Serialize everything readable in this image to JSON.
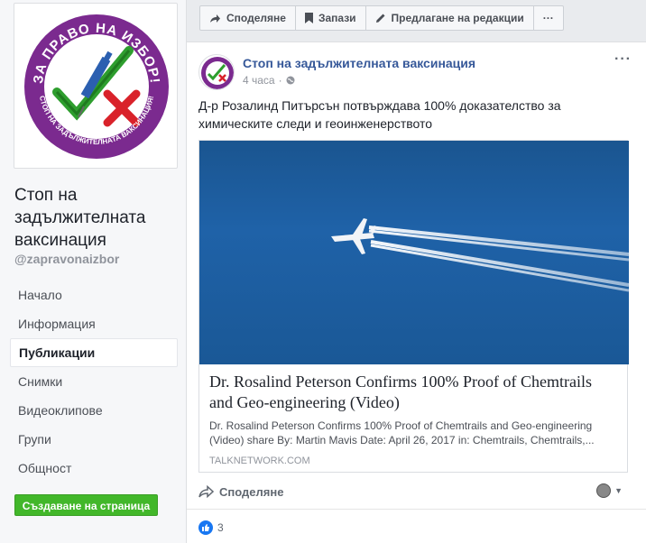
{
  "sidebar": {
    "page_name": "Стоп на задължителната ваксинация",
    "handle": "@zapravonaizbor",
    "logo_text_top": "ЗА ПРАВО НА ИЗБОР!",
    "logo_text_bottom": "СТОП НА ЗАДЪЛЖИТЕЛНАТА ВАКСИНАЦИЯ!",
    "nav_items": [
      {
        "label": "Начало",
        "active": false
      },
      {
        "label": "Информация",
        "active": false
      },
      {
        "label": "Публикации",
        "active": true
      },
      {
        "label": "Снимки",
        "active": false
      },
      {
        "label": "Видеоклипове",
        "active": false
      },
      {
        "label": "Групи",
        "active": false
      },
      {
        "label": "Общност",
        "active": false
      }
    ],
    "create_page_label": "Създаване на страница"
  },
  "action_bar": {
    "share_label": "Споделяне",
    "save_label": "Запази",
    "suggest_edit_label": "Предлагане на редакции",
    "more_label": "···"
  },
  "post": {
    "author": "Стоп на задължителната ваксинация",
    "time": "4 часа",
    "text": "Д-р Розалинд Питърсън потвърждава 100% доказателство за химическите следи и геоинженерството",
    "link": {
      "title": "Dr. Rosalind Peterson Confirms 100% Proof of Chemtrails and Geo-engineering (Video)",
      "description": "Dr. Rosalind Peterson Confirms 100% Proof of Chemtrails and Geo-engineering (Video) share By: Martin Mavis Date: April 26, 2017 in: Chemtrails, Chemtrails,...",
      "domain": "TALKNETWORK.COM"
    },
    "share_label": "Споделяне",
    "like_count": "3"
  },
  "colors": {
    "accent_link": "#365899",
    "create_button": "#42b72a",
    "like_blue": "#1877f2",
    "sky": "#1f62a8"
  }
}
